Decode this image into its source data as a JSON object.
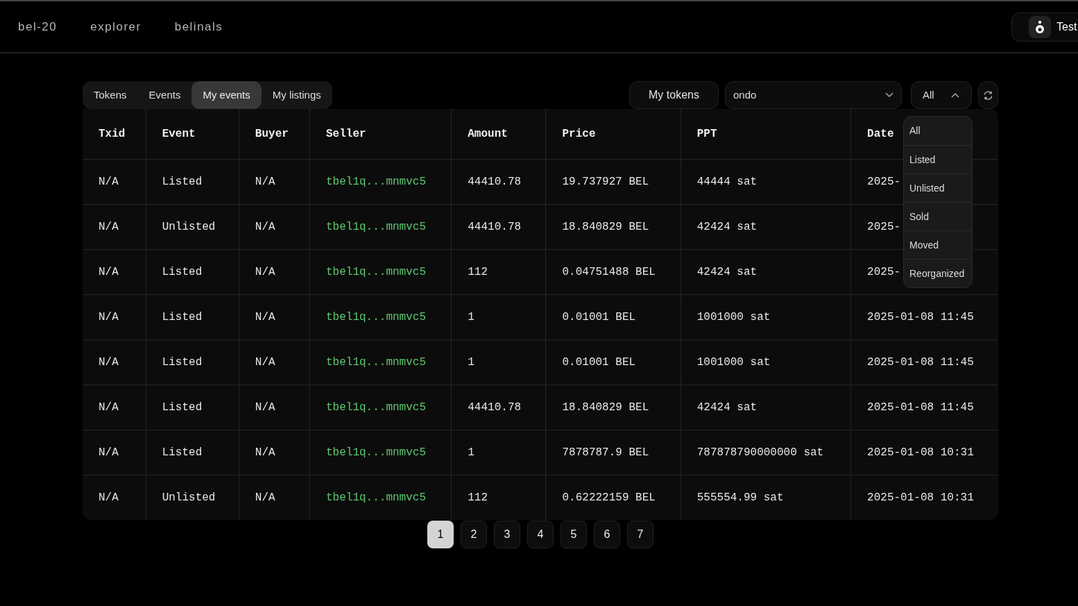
{
  "nav": {
    "links": [
      "bel-20",
      "explorer",
      "belinals"
    ],
    "account_button": "Test"
  },
  "tabs": [
    {
      "label": "Tokens",
      "selected": false
    },
    {
      "label": "Events",
      "selected": false
    },
    {
      "label": "My events",
      "selected": true
    },
    {
      "label": "My listings",
      "selected": false
    }
  ],
  "my_tokens_button": "My tokens",
  "token_select": {
    "value": "ondo"
  },
  "event_filter": {
    "value": "All",
    "expanded": true,
    "options": [
      "All",
      "Listed",
      "Unlisted",
      "Sold",
      "Moved",
      "Reorganized"
    ]
  },
  "table": {
    "columns": [
      "Txid",
      "Event",
      "Buyer",
      "Seller",
      "Amount",
      "Price",
      "PPT",
      "Date"
    ],
    "rows": [
      [
        "N/A",
        "Listed",
        "N/A",
        "tbel1q...mnmvc5",
        "44410.78",
        "19.737927 BEL",
        "44444 sat",
        "2025-"
      ],
      [
        "N/A",
        "Unlisted",
        "N/A",
        "tbel1q...mnmvc5",
        "44410.78",
        "18.840829 BEL",
        "42424 sat",
        "2025-"
      ],
      [
        "N/A",
        "Listed",
        "N/A",
        "tbel1q...mnmvc5",
        "112",
        "0.04751488 BEL",
        "42424 sat",
        "2025-"
      ],
      [
        "N/A",
        "Listed",
        "N/A",
        "tbel1q...mnmvc5",
        "1",
        "0.01001 BEL",
        "1001000 sat",
        "2025-01-08 11:45"
      ],
      [
        "N/A",
        "Listed",
        "N/A",
        "tbel1q...mnmvc5",
        "1",
        "0.01001 BEL",
        "1001000 sat",
        "2025-01-08 11:45"
      ],
      [
        "N/A",
        "Listed",
        "N/A",
        "tbel1q...mnmvc5",
        "44410.78",
        "18.840829 BEL",
        "42424 sat",
        "2025-01-08 11:45"
      ],
      [
        "N/A",
        "Listed",
        "N/A",
        "tbel1q...mnmvc5",
        "1",
        "7878787.9 BEL",
        "787878790000000 sat",
        "2025-01-08 10:31"
      ],
      [
        "N/A",
        "Unlisted",
        "N/A",
        "tbel1q...mnmvc5",
        "112",
        "0.62222159 BEL",
        "555554.99 sat",
        "2025-01-08 10:31"
      ]
    ]
  },
  "pagination": [
    {
      "label": "1",
      "selected": true
    },
    {
      "label": "2",
      "selected": false
    },
    {
      "label": "3",
      "selected": false
    },
    {
      "label": "4",
      "selected": false
    },
    {
      "label": "5",
      "selected": false
    },
    {
      "label": "6",
      "selected": false
    },
    {
      "label": "7",
      "selected": false
    }
  ]
}
